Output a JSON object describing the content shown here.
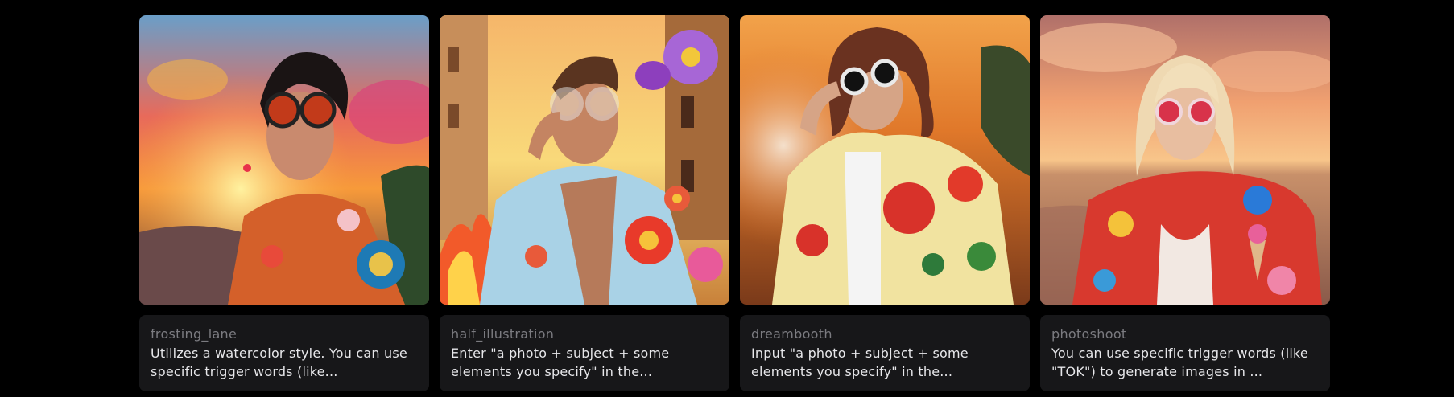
{
  "models": [
    {
      "name": "frosting_lane",
      "description": "Utilizes a watercolor style. You can use specific trigger words (like...",
      "image_alt": "Person in round red sunglasses and a floral patterned jacket against a sunset sky"
    },
    {
      "name": "half_illustration",
      "description": "Enter \"a photo + subject + some elements you specify\" in the...",
      "image_alt": "Man holding jeweled glasses wearing a light blue jacket with illustrated flowers"
    },
    {
      "name": "dreambooth",
      "description": "Input \"a photo + subject + some elements you specify\" in the...",
      "image_alt": "Woman adjusting round sunglasses wearing a yellow jacket with red roses"
    },
    {
      "name": "photoshoot",
      "description": "You can use specific trigger words (like \"TOK\") to generate images in ...",
      "image_alt": "Blonde woman in pink round sunglasses and red floral jacket at a beach sunset"
    }
  ]
}
